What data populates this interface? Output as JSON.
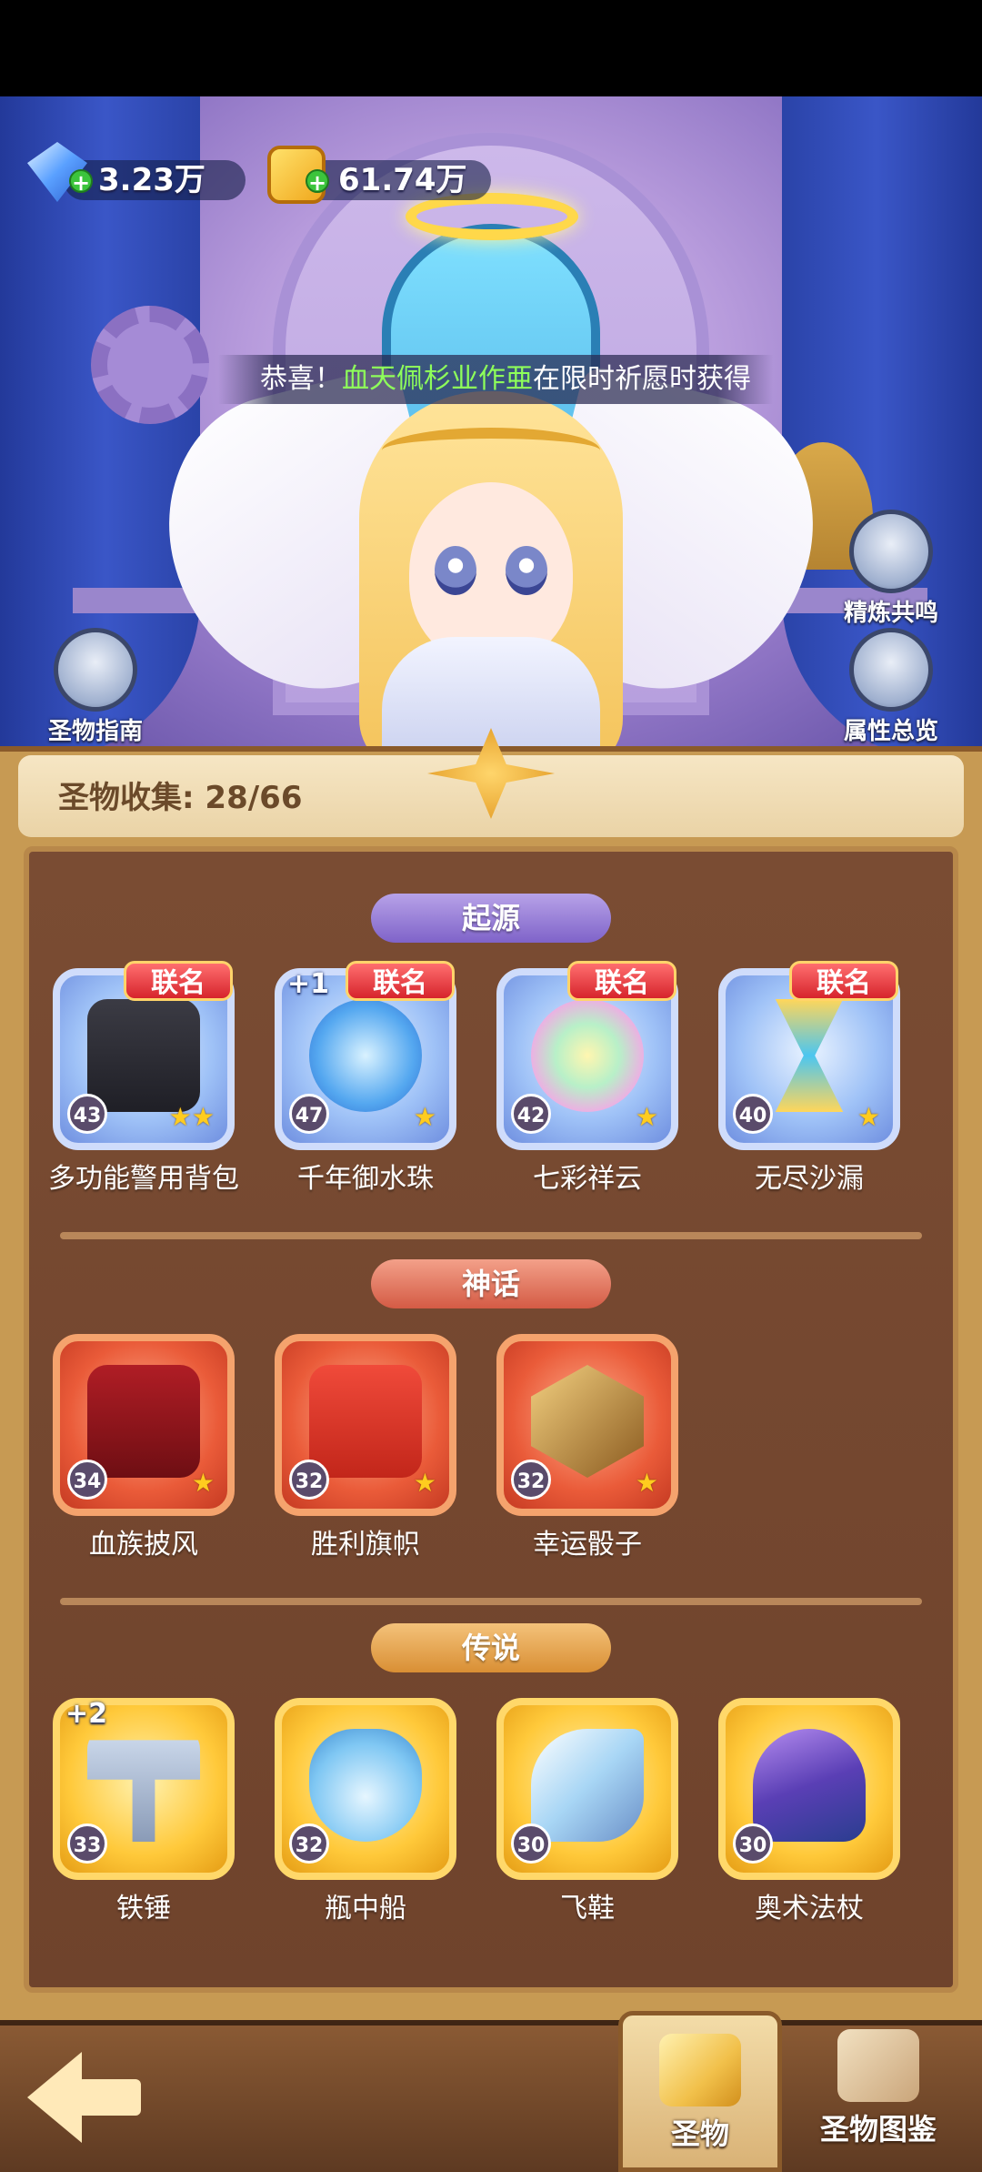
{
  "currency": {
    "gems": "3.23万",
    "gold": "61.74万",
    "gem_icon": "diamond-icon",
    "gold_icon": "coin-icon"
  },
  "marquee": {
    "prefix": "恭喜！",
    "player": "血天佩杉业作亜",
    "suffix": "在限时祈愿时获得"
  },
  "side_buttons": {
    "guide": "圣物指南",
    "resonance": "精炼共鸣",
    "attributes": "属性总览"
  },
  "collection": {
    "label": "圣物收集: 28/66"
  },
  "sections": [
    {
      "title": "起源",
      "rarity": "origin",
      "relics": [
        {
          "name": "多功能警用背包",
          "level": "43",
          "badge": "联名",
          "plus": "",
          "stars": "★★"
        },
        {
          "name": "千年御水珠",
          "level": "47",
          "badge": "联名",
          "plus": "+1",
          "stars": "★"
        },
        {
          "name": "七彩祥云",
          "level": "42",
          "badge": "联名",
          "plus": "",
          "stars": "★"
        },
        {
          "name": "无尽沙漏",
          "level": "40",
          "badge": "联名",
          "plus": "",
          "stars": "★"
        }
      ]
    },
    {
      "title": "神话",
      "rarity": "myth",
      "relics": [
        {
          "name": "血族披风",
          "level": "34",
          "badge": "",
          "plus": "",
          "stars": "★"
        },
        {
          "name": "胜利旗帜",
          "level": "32",
          "badge": "",
          "plus": "",
          "stars": "★"
        },
        {
          "name": "幸运骰子",
          "level": "32",
          "badge": "",
          "plus": "",
          "stars": "★"
        }
      ]
    },
    {
      "title": "传说",
      "rarity": "legend",
      "relics": [
        {
          "name": "铁锤",
          "level": "33",
          "badge": "",
          "plus": "+2",
          "stars": ""
        },
        {
          "name": "瓶中船",
          "level": "32",
          "badge": "",
          "plus": "",
          "stars": ""
        },
        {
          "name": "飞鞋",
          "level": "30",
          "badge": "",
          "plus": "",
          "stars": ""
        },
        {
          "name": "奥术法杖",
          "level": "30",
          "badge": "",
          "plus": "",
          "stars": ""
        }
      ]
    }
  ],
  "bottom_tabs": {
    "relics": "圣物",
    "codex": "圣物图鉴"
  }
}
